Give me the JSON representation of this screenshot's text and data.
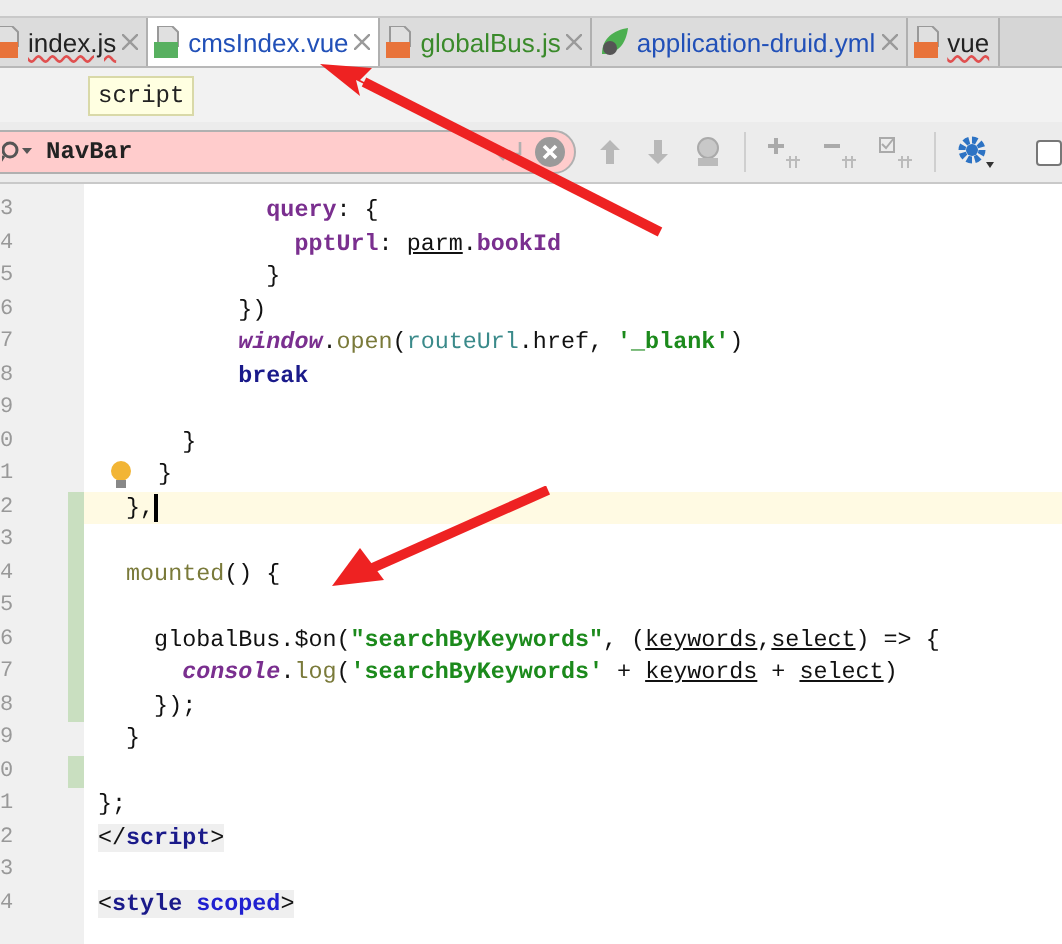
{
  "tabs": [
    {
      "label": "index.js",
      "kind": "js",
      "selected": false,
      "color": "#222222",
      "error": true
    },
    {
      "label": "cmsIndex.vue",
      "kind": "vue",
      "selected": true,
      "color": "#2150b8",
      "error": false
    },
    {
      "label": "globalBus.js",
      "kind": "js",
      "selected": false,
      "color": "#3a8a2a",
      "error": false
    },
    {
      "label": "application-druid.yml",
      "kind": "yml",
      "selected": false,
      "color": "#2150b8",
      "error": false
    },
    {
      "label": "vue",
      "kind": "js",
      "selected": false,
      "color": "#222222",
      "error": true
    }
  ],
  "tooltip": "script",
  "search": {
    "value": "NavBar",
    "no_match": true
  },
  "match_case_checkbox": {
    "checked": false
  },
  "lines": [
    {
      "num": "3",
      "tokens": [
        {
          "t": "            query",
          "kind": "prop"
        },
        {
          "t": ": {",
          "kind": "plain"
        }
      ]
    },
    {
      "num": "4",
      "tokens": [
        {
          "t": "              pptUrl",
          "kind": "prop"
        },
        {
          "t": ": ",
          "kind": "plain"
        },
        {
          "t": "parm",
          "kind": "var"
        },
        {
          "t": ".",
          "kind": "plain"
        },
        {
          "t": "bookId",
          "kind": "prop"
        }
      ]
    },
    {
      "num": "5",
      "tokens": [
        {
          "t": "            }",
          "kind": "plain"
        }
      ]
    },
    {
      "num": "6",
      "tokens": [
        {
          "t": "          })",
          "kind": "plain"
        }
      ]
    },
    {
      "num": "7",
      "tokens": [
        {
          "t": "          window",
          "kind": "global"
        },
        {
          "t": ".",
          "kind": "plain"
        },
        {
          "t": "open",
          "kind": "fn"
        },
        {
          "t": "(",
          "kind": "plain"
        },
        {
          "t": "routeUrl",
          "kind": "param"
        },
        {
          "t": ".href, ",
          "kind": "plain"
        },
        {
          "t": "'_blank'",
          "kind": "string"
        },
        {
          "t": ")",
          "kind": "plain"
        }
      ]
    },
    {
      "num": "8",
      "tokens": [
        {
          "t": "          break",
          "kind": "keyword"
        }
      ]
    },
    {
      "num": "9"
    },
    {
      "num": "0",
      "tokens": [
        {
          "t": "      }",
          "kind": "plain"
        }
      ]
    },
    {
      "num": "1",
      "tokens": [
        {
          "t": "}",
          "kind": "plain"
        }
      ],
      "bulb": true
    },
    {
      "num": "2",
      "tokens": [
        {
          "t": "  },",
          "kind": "plain"
        }
      ],
      "current": true,
      "changed": true
    },
    {
      "num": "3",
      "changed": true
    },
    {
      "num": "4",
      "tokens": [
        {
          "t": "  mounted",
          "kind": "fn"
        },
        {
          "t": "() {",
          "kind": "plain"
        }
      ],
      "changed": true
    },
    {
      "num": "5",
      "changed": true
    },
    {
      "num": "6",
      "tokens": [
        {
          "t": "    globalBus.$on(",
          "kind": "plain"
        },
        {
          "t": "\"searchByKeywords\"",
          "kind": "string"
        },
        {
          "t": ", (",
          "kind": "plain"
        },
        {
          "t": "keywords",
          "kind": "var"
        },
        {
          "t": ",",
          "kind": "plain"
        },
        {
          "t": "select",
          "kind": "var"
        },
        {
          "t": ") => {",
          "kind": "plain"
        }
      ],
      "changed": true
    },
    {
      "num": "7",
      "tokens": [
        {
          "t": "      console",
          "kind": "global"
        },
        {
          "t": ".",
          "kind": "plain"
        },
        {
          "t": "log",
          "kind": "fn"
        },
        {
          "t": "(",
          "kind": "plain"
        },
        {
          "t": "'searchByKeywords'",
          "kind": "string"
        },
        {
          "t": " + ",
          "kind": "plain"
        },
        {
          "t": "keywords",
          "kind": "var"
        },
        {
          "t": " + ",
          "kind": "plain"
        },
        {
          "t": "select",
          "kind": "var"
        },
        {
          "t": ")",
          "kind": "plain"
        }
      ],
      "changed": true
    },
    {
      "num": "8",
      "tokens": [
        {
          "t": "    });",
          "kind": "plain"
        }
      ],
      "changed": true
    },
    {
      "num": "9",
      "tokens": [
        {
          "t": "  }",
          "kind": "plain"
        }
      ]
    },
    {
      "num": "0",
      "changed": true
    },
    {
      "num": "1",
      "tokens": [
        {
          "t": "};",
          "kind": "plain"
        }
      ]
    },
    {
      "num": "2",
      "tokens": [
        {
          "t": "</",
          "kind": "plain"
        },
        {
          "t": "script",
          "kind": "tag"
        },
        {
          "t": ">",
          "kind": "plain"
        }
      ],
      "tagline": true
    },
    {
      "num": "3"
    },
    {
      "num": "4",
      "tokens": [
        {
          "t": "<",
          "kind": "plain"
        },
        {
          "t": "style",
          "kind": "tag"
        },
        {
          "t": " scoped",
          "kind": "attr"
        },
        {
          "t": ">",
          "kind": "plain"
        }
      ],
      "tagline": true
    }
  ]
}
